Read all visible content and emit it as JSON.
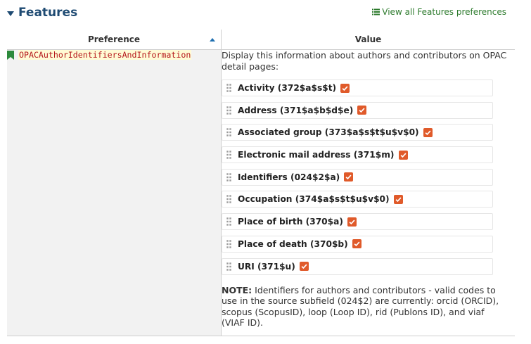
{
  "header": {
    "section_title": "Features",
    "view_all_label": "View all Features preferences"
  },
  "table": {
    "columns": {
      "preference": "Preference",
      "value": "Value"
    },
    "row": {
      "preference_name": "OPACAuthorIdentifiersAndInformation",
      "intro": "Display this information about authors and contributors on OPAC detail pages:",
      "options": [
        {
          "label": "Activity (372$a$s$t)",
          "checked": true
        },
        {
          "label": "Address (371$a$b$d$e)",
          "checked": true
        },
        {
          "label": "Associated group (373$a$s$t$u$v$0)",
          "checked": true
        },
        {
          "label": "Electronic mail address (371$m)",
          "checked": true
        },
        {
          "label": "Identifiers (024$2$a)",
          "checked": true
        },
        {
          "label": "Occupation (374$a$s$t$u$v$0)",
          "checked": true
        },
        {
          "label": "Place of birth (370$a)",
          "checked": true
        },
        {
          "label": "Place of death (370$b)",
          "checked": true
        },
        {
          "label": "URI (371$u)",
          "checked": true
        }
      ],
      "note_label": "NOTE:",
      "note_text": " Identifiers for authors and contributors - valid codes to use in the source subfield (024$2) are currently: orcid (ORCID), scopus (ScopusID), loop (Loop ID), rid (Publons ID), and viaf (VIAF ID)."
    }
  },
  "colors": {
    "title": "#1e4a72",
    "link": "#2c7a2c",
    "pref_code": "#b5161b",
    "pref_code_bg": "#fffbd5",
    "checkbox": "#e05a2a",
    "pref_cell_bg": "#f2f2f2"
  },
  "icons": {
    "section_toggle": "caret-down-icon",
    "view_all": "list-icon",
    "sort": "sort-asc-icon",
    "preference": "bookmark-icon",
    "drag": "drag-handle-icon",
    "checkbox": "checkmark-icon"
  }
}
